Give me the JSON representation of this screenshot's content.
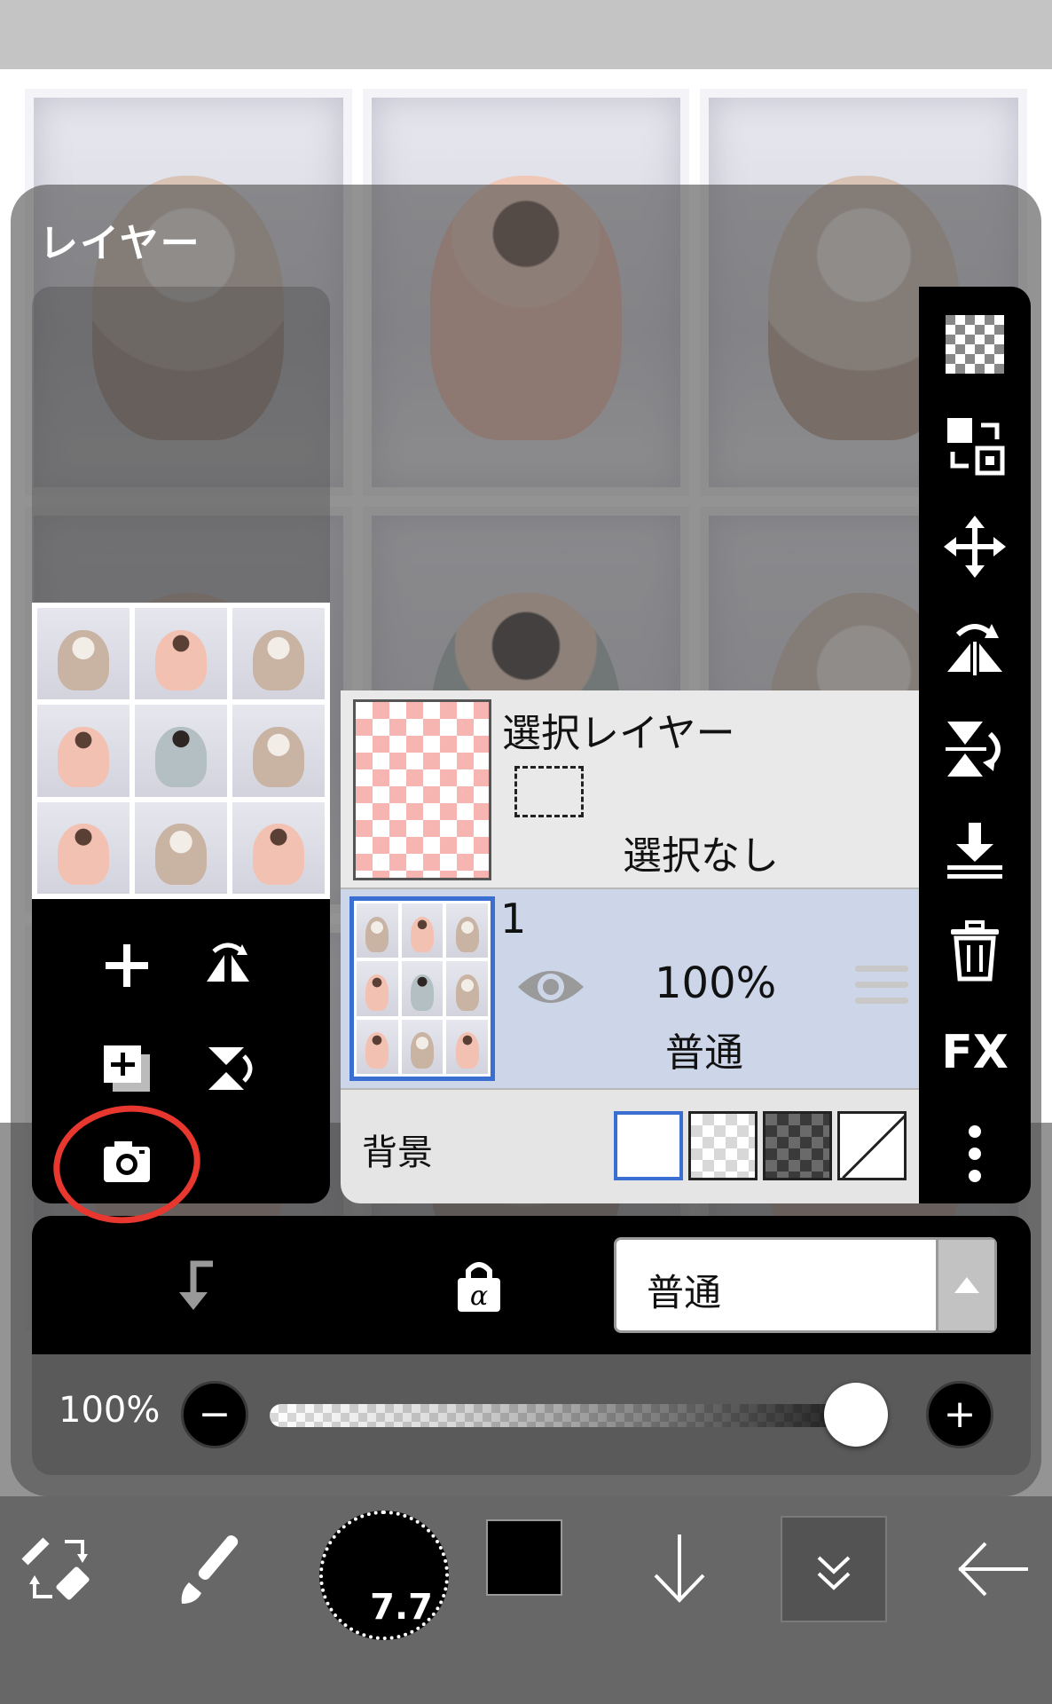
{
  "panel": {
    "title": "レイヤー"
  },
  "layers": {
    "selection_layer": {
      "name": "選択レイヤー",
      "status": "選択なし"
    },
    "layer1": {
      "name": "1",
      "opacity": "100%",
      "blend_mode": "普通"
    }
  },
  "background": {
    "label": "背景",
    "options": [
      "white",
      "light-checker",
      "dark-checker",
      "none"
    ],
    "selected": "white"
  },
  "blend_bar": {
    "selected_mode": "普通"
  },
  "opacity": {
    "label": "100%",
    "value": 1.0
  },
  "side_toolbar": {
    "fx_label": "FX"
  },
  "bottom_toolbar": {
    "brush_size": "7.7",
    "color": "#000000"
  },
  "colors": {
    "selected_layer_bg": "#ccd6e8",
    "accent_blue": "#3a6fd1",
    "annotation_red": "#e8372f"
  }
}
